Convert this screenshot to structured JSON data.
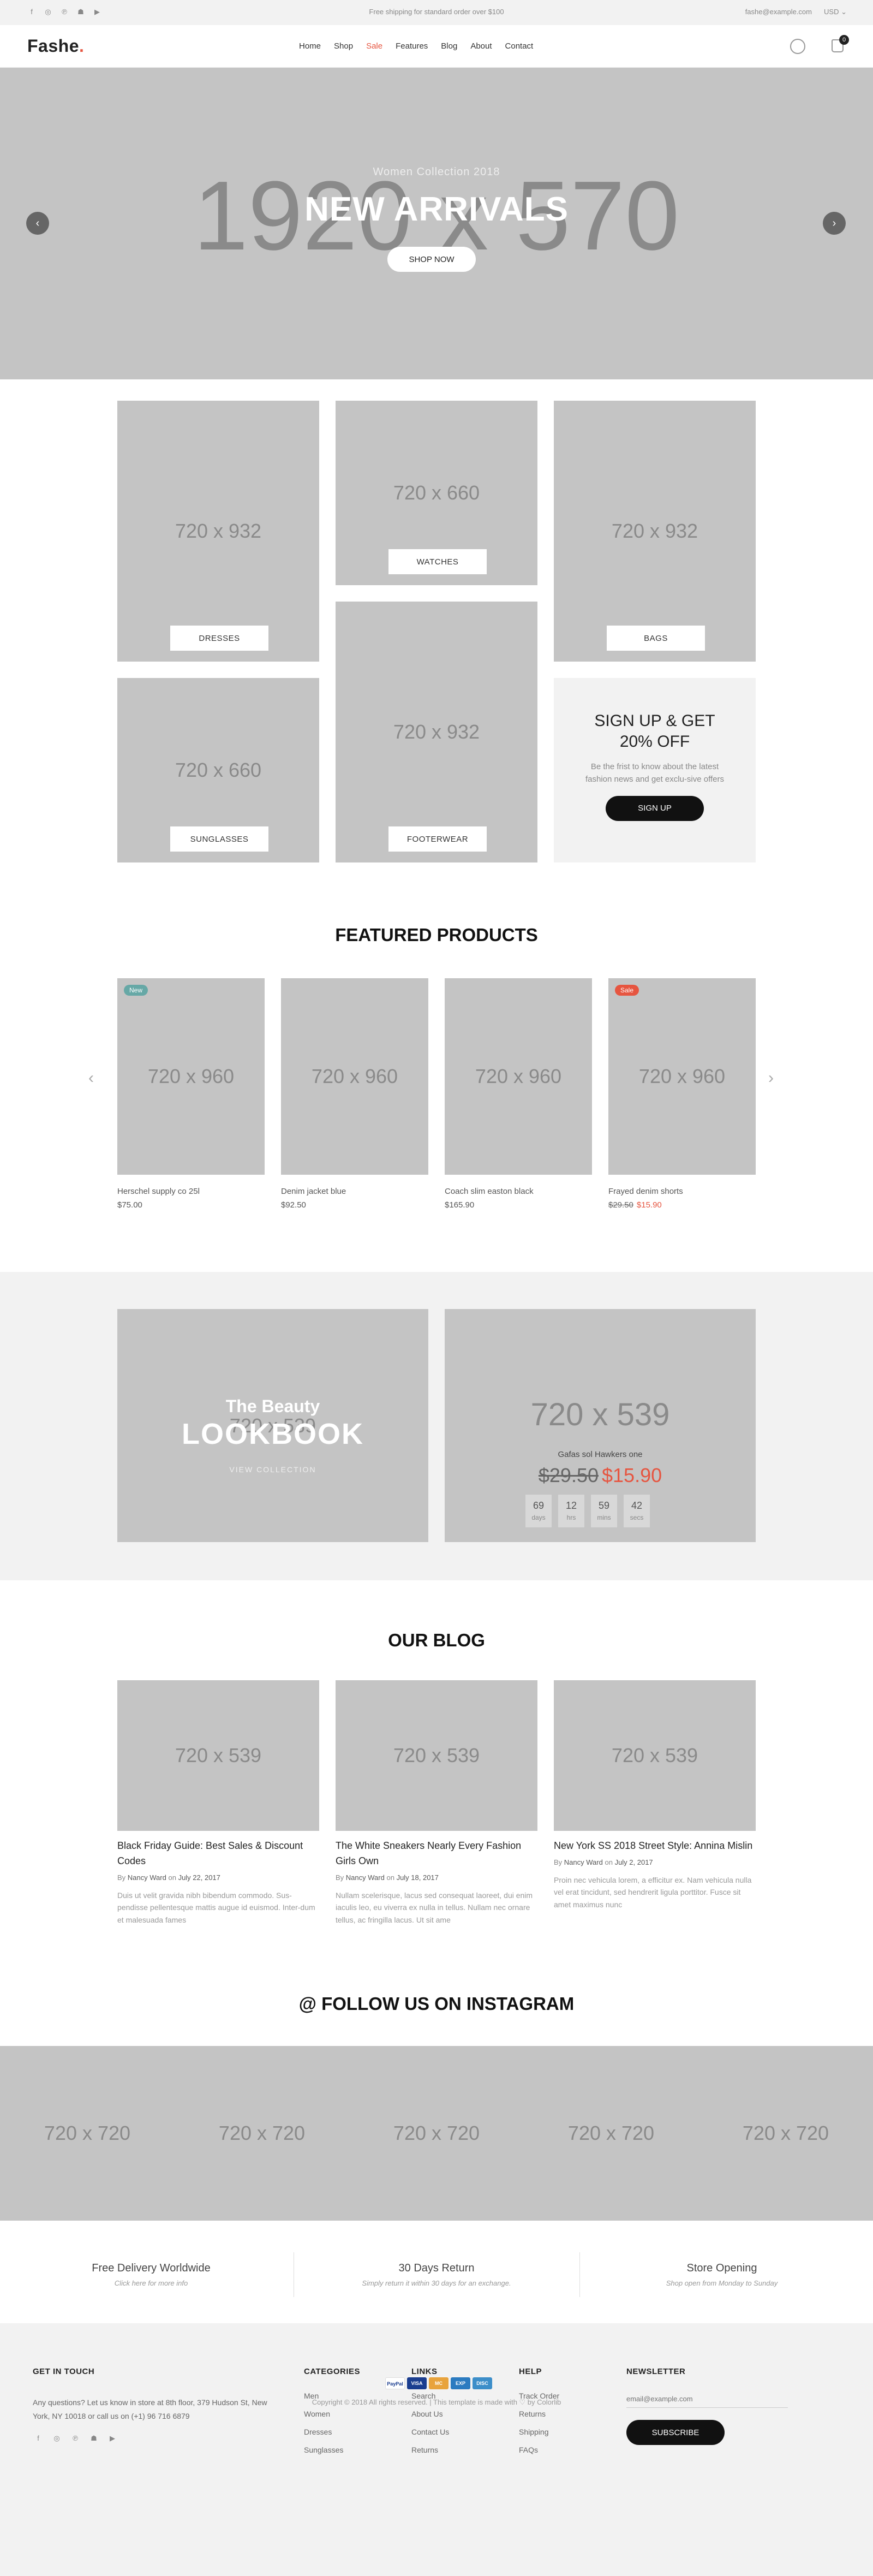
{
  "topbar": {
    "social_icons": [
      "facebook-icon",
      "instagram-icon",
      "pinterest-icon",
      "snapchat-icon",
      "youtube-icon"
    ],
    "shipping_text": "Free shipping for standard order over $100",
    "email": "fashe@example.com",
    "currency": "USD"
  },
  "header": {
    "logo_text": "Fashe",
    "logo_dot": ".",
    "nav": [
      "Home",
      "Shop",
      "Sale",
      "Features",
      "Blog",
      "About",
      "Contact"
    ],
    "cart_count": "0"
  },
  "hero": {
    "placeholder": "1920 x 570",
    "subtitle": "Women Collection 2018",
    "title": "NEW ARRIVALS",
    "button": "SHOP NOW",
    "prev": "‹",
    "next": "›"
  },
  "categories": [
    {
      "size": "720 x 932",
      "label": "DRESSES"
    },
    {
      "size": "720 x 660",
      "label": "WATCHES"
    },
    {
      "size": "720 x 932",
      "label": "BAGS"
    },
    {
      "size": "720 x 660",
      "label": "SUNGLASSES"
    },
    {
      "size": "720 x 932",
      "label": "FOOTERWEAR"
    }
  ],
  "signup": {
    "title_line1": "SIGN UP & GET",
    "title_line2": "20% OFF",
    "text": "Be the frist to know about the latest fashion news and get exclu-sive offers",
    "button": "SIGN UP"
  },
  "featured": {
    "title": "FEATURED PRODUCTS",
    "products": [
      {
        "size": "720 x 960",
        "badge": "New",
        "name": "Herschel supply co 25l",
        "price": "$75.00",
        "old_price": "",
        "new_price": ""
      },
      {
        "size": "720 x 960",
        "badge": "",
        "name": "Denim jacket blue",
        "price": "$92.50",
        "old_price": "",
        "new_price": ""
      },
      {
        "size": "720 x 960",
        "badge": "",
        "name": "Coach slim easton black",
        "price": "$165.90",
        "old_price": "",
        "new_price": ""
      },
      {
        "size": "720 x 960",
        "badge": "Sale",
        "name": "Frayed denim shorts",
        "price": "",
        "old_price": "$29.50",
        "new_price": "$15.90"
      }
    ],
    "prev": "‹",
    "next": "›"
  },
  "lookbook": {
    "size": "720 x 539",
    "subtitle": "The Beauty",
    "title": "LOOKBOOK",
    "link": "VIEW COLLECTION"
  },
  "deal": {
    "size": "720 x 539",
    "name": "Gafas sol Hawkers one",
    "old_price": "$29.50",
    "new_price": "$15.90",
    "countdown": [
      {
        "value": "69",
        "unit": "days"
      },
      {
        "value": "12",
        "unit": "hrs"
      },
      {
        "value": "59",
        "unit": "mins"
      },
      {
        "value": "42",
        "unit": "secs"
      }
    ]
  },
  "blog": {
    "title": "OUR BLOG",
    "posts": [
      {
        "size": "720 x 539",
        "title": "Black Friday Guide: Best Sales & Discount Codes",
        "by": "By",
        "author": "Nancy Ward",
        "on": "on",
        "date": "July 22, 2017",
        "text": "Duis ut velit gravida nibh bibendum commodo. Sus-pendisse pellentesque mattis augue id euismod. Inter-dum et malesuada fames"
      },
      {
        "size": "720 x 539",
        "title": "The White Sneakers Nearly Every Fashion Girls Own",
        "by": "By",
        "author": "Nancy Ward",
        "on": "on",
        "date": "July 18, 2017",
        "text": "Nullam scelerisque, lacus sed consequat laoreet, dui enim iaculis leo, eu viverra ex nulla in tellus. Nullam nec ornare tellus, ac fringilla lacus. Ut sit ame"
      },
      {
        "size": "720 x 539",
        "title": "New York SS 2018 Street Style: Annina Mislin",
        "by": "By",
        "author": "Nancy Ward",
        "on": "on",
        "date": "July 2, 2017",
        "text": "Proin nec vehicula lorem, a efficitur ex. Nam vehicula nulla vel erat tincidunt, sed hendrerit ligula porttitor. Fusce sit amet maximus nunc"
      }
    ]
  },
  "instagram": {
    "title": "@ FOLLOW US ON INSTAGRAM",
    "tiles": [
      "720 x 720",
      "720 x 720",
      "720 x 720",
      "720 x 720",
      "720 x 720"
    ]
  },
  "features": [
    {
      "title": "Free Delivery Worldwide",
      "sub": "Click here for more info"
    },
    {
      "title": "30 Days Return",
      "sub": "Simply return it within 30 days for an exchange."
    },
    {
      "title": "Store Opening",
      "sub": "Shop open from Monday to Sunday"
    }
  ],
  "footer": {
    "contact_title": "GET IN TOUCH",
    "contact_text": "Any questions? Let us know in store at 8th floor, 379 Hudson St, New York, NY 10018 or call us on (+1) 96 716 6879",
    "categories_title": "CATEGORIES",
    "categories": [
      "Men",
      "Women",
      "Dresses",
      "Sunglasses"
    ],
    "links_title": "LINKS",
    "links": [
      "Search",
      "About Us",
      "Contact Us",
      "Returns"
    ],
    "help_title": "HELP",
    "help": [
      "Track Order",
      "Returns",
      "Shipping",
      "FAQs"
    ],
    "newsletter_title": "NEWSLETTER",
    "newsletter_placeholder": "email@example.com",
    "newsletter_button": "SUBSCRIBE",
    "payments": [
      "PayPal",
      "VISA",
      "MC",
      "EXP",
      "DISC"
    ],
    "copyright": "Copyright © 2018 All rights reserved. | This template is made with ♡ by Colorlib"
  },
  "colors": {
    "accent": "#e65540",
    "new_badge": "#66a8a6",
    "placeholder": "#c4c4c4",
    "dark": "#111111",
    "light_bg": "#f2f2f2"
  }
}
